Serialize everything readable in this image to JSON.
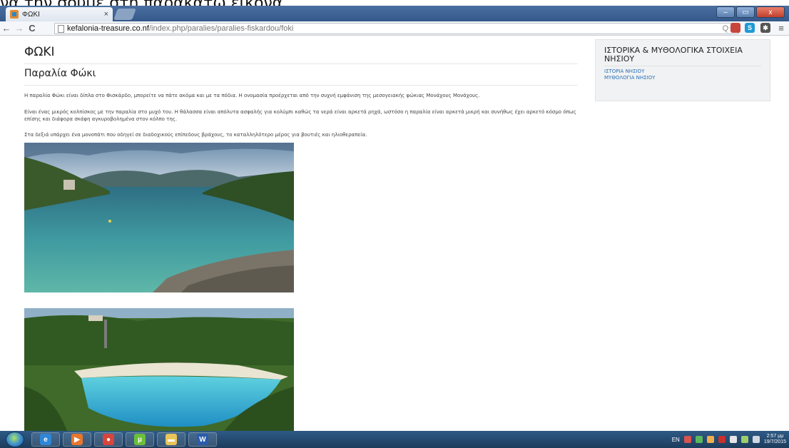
{
  "overlay_caption": "να την σουμε στη παρακατω εικονα",
  "browser": {
    "tab_title": "ΦΩΚΙ",
    "tab_close": "×",
    "url_host": "kefalonia-treasure.co.nf",
    "url_path": "/index.php/paralies/paralies-fiskardou/foki",
    "back": "←",
    "forward": "→",
    "reload": "C",
    "omni_icons": "Q☆",
    "menu": "≡",
    "window_buttons": {
      "minimize": "–",
      "restore": "▭",
      "close": "x"
    },
    "extensions": [
      {
        "name": "adblock-extension-icon",
        "label": "",
        "color": "#c8453c"
      },
      {
        "name": "skype-extension-icon",
        "label": "S",
        "color": "#1e9ad6"
      },
      {
        "name": "puzzle-extension-icon",
        "label": "✱",
        "color": "#555555"
      }
    ]
  },
  "page": {
    "title": "ΦΩΚΙ",
    "subtitle": "Παραλία Φώκι",
    "paragraphs": [
      "Η παραλία Φώκι είναι δίπλα στο Φισκάρδο, μπορείτε να πάτε ακόμα και με τα πόδια. Η ονομασία προέρχεται από την συχνή εμφάνιση της μεσογειακής φώκιας Μονάχους Μονάχους.",
      "Είναι ένας μικρός κολπίσκος με την παραλία στο μυχό του. Η θάλασσα είναι απόλυτα ασφαλής για κολύμπι καθώς τα νερά είναι αρκετά ρηχά, ωστόσο η παραλία είναι αρκετά μικρή και συνήθως έχει αρκετό κόσμο όπως επίσης και διάφορα σκάφη αγκυροβολημένα στον κόλπο της.",
      "Στα δεξιά υπάρχει ένα μονοπάτι που οδηγεί σε διαδοχικούς επίπεδους βράχους, το καταλληλότερο μέρος για βουτιές και ηλιοθεραπεία."
    ]
  },
  "sidebar": {
    "title": "ΙΣΤΟΡΙΚΑ & ΜΥΘΟΛΟΓΙΚΑ ΣΤΟΙΧΕΙΑ ΝΗΣΙΟΥ",
    "links": [
      "ΙΣΤΟΡΙΑ ΝΗΣΙΟΥ",
      "ΜΥΘΟΛΟΓΙΑ ΝΗΣΙΟΥ"
    ]
  },
  "taskbar": {
    "items": [
      {
        "name": "internet-explorer-icon",
        "label": "e",
        "color": "#2f86d6"
      },
      {
        "name": "media-player-icon",
        "label": "▶",
        "color": "#e8762b"
      },
      {
        "name": "chrome-icon",
        "label": "●",
        "color": "#d8453a"
      },
      {
        "name": "utorrent-icon",
        "label": "µ",
        "color": "#6cbf3a"
      },
      {
        "name": "folder-icon",
        "label": "▬",
        "color": "#e9c45a"
      },
      {
        "name": "word-icon",
        "label": "W",
        "color": "#2a5caa"
      }
    ],
    "language": "EN",
    "clock_time": "2:57 μμ",
    "clock_date": "19/7/2015"
  }
}
